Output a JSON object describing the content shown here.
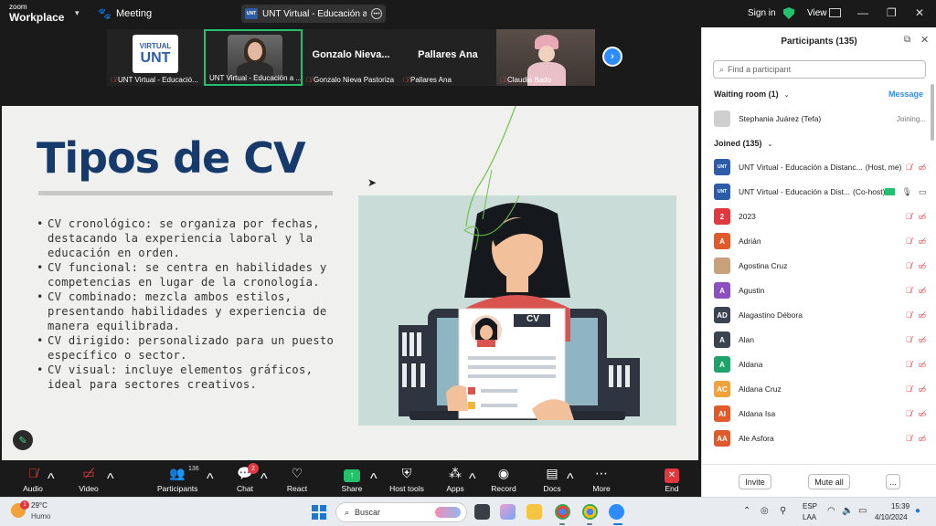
{
  "titlebar": {
    "logo_line1": "zoom",
    "logo_line2": "Workplace",
    "meeting_label": "Meeting",
    "window_title": "UNT Virtual - Educación a Distan",
    "sign_in": "Sign in",
    "view": "View"
  },
  "video_strip": [
    {
      "name": "UNT Virtual - Educació...",
      "muted": true
    },
    {
      "name": "UNT Virtual - Educación a ...",
      "muted": false,
      "active": true
    },
    {
      "display": "Gonzalo  Nieva...",
      "name": "Gonzalo Nieva Pastoriza",
      "muted": true
    },
    {
      "display": "Pallares Ana",
      "name": "Pallares Ana",
      "muted": true
    },
    {
      "name": "Claudia Bado",
      "muted": true
    }
  ],
  "slide": {
    "title": "Tipos de CV",
    "bullets": [
      "CV cronológico: se organiza por fechas, destacando la experiencia laboral y la educación en orden.",
      "CV funcional: se centra en habilidades y competencias en lugar de la cronología.",
      "CV combinado: mezcla ambos estilos, presentando habilidades y experiencia de manera equilibrada.",
      "CV dirigido: personalizado para un puesto específico o sector.",
      "CV visual: incluye elementos gráficos, ideal para sectores creativos."
    ],
    "illustration_label": "CV"
  },
  "toolbar": {
    "audio": "Audio",
    "video": "Video",
    "participants": "Participants",
    "participants_count": "136",
    "chat": "Chat",
    "chat_badge": "2",
    "react": "React",
    "share": "Share",
    "host_tools": "Host tools",
    "apps": "Apps",
    "record": "Record",
    "docs": "Docs",
    "more": "More",
    "end": "End"
  },
  "panel": {
    "title": "Participants (135)",
    "search_placeholder": "Find a participant",
    "waiting_room": "Waiting room (1)",
    "message": "Message",
    "waiting": [
      {
        "name": "Stephania Juárez (Tefa)",
        "status": "Joining..."
      }
    ],
    "joined": "Joined (135)",
    "participants": [
      {
        "initials": "UNT",
        "color": "#2d5da8",
        "name": "UNT Virtual - Educación a Distanc...",
        "tag": "(Host, me)"
      },
      {
        "initials": "UNT",
        "color": "#2d5da8",
        "name": "UNT Virtual - Educación a Dist...",
        "tag": "(Co-host)"
      },
      {
        "initials": "2",
        "color": "#e0383e",
        "name": "2023",
        "tag": ""
      },
      {
        "initials": "A",
        "color": "#e05a2b",
        "name": "Adrián",
        "tag": ""
      },
      {
        "initials": "",
        "color": "#c8a07a",
        "name": "Agostina Cruz",
        "tag": ""
      },
      {
        "initials": "A",
        "color": "#8e4fc0",
        "name": "Agustin",
        "tag": ""
      },
      {
        "initials": "AD",
        "color": "#3c4452",
        "name": "Alagastino Débora",
        "tag": ""
      },
      {
        "initials": "A",
        "color": "#3c4452",
        "name": "Alan",
        "tag": ""
      },
      {
        "initials": "A",
        "color": "#1fa36a",
        "name": "Aldana",
        "tag": ""
      },
      {
        "initials": "AC",
        "color": "#f2a23a",
        "name": "Aldana Cruz",
        "tag": ""
      },
      {
        "initials": "AI",
        "color": "#e05a2b",
        "name": "Aldana Isa",
        "tag": ""
      },
      {
        "initials": "AA",
        "color": "#e05a2b",
        "name": "Ale Asfora",
        "tag": ""
      }
    ],
    "invite": "Invite",
    "mute_all": "Mute all",
    "more": "..."
  },
  "taskbar": {
    "temp": "29°C",
    "condition": "Humo",
    "weather_badge": "1",
    "search": "Buscar",
    "lang1": "ESP",
    "lang2": "LAA",
    "time": "15:39",
    "date": "4/10/2024"
  },
  "colors": {
    "accent": "#2d8cff",
    "muted_red": "#e0383e",
    "slide_title": "#163a6b",
    "secure_green": "#23c16b"
  }
}
